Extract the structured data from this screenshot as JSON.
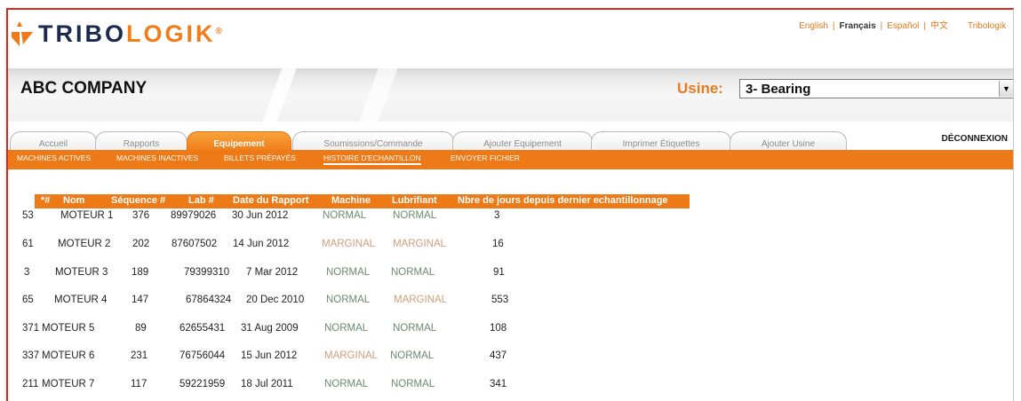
{
  "header": {
    "brand": {
      "part1": "TRIBO",
      "part2": "LOGIK",
      "mark": "®"
    },
    "languages": [
      "English",
      "Français",
      "Español",
      "中文"
    ],
    "active_language": "Français",
    "brand_link": "Tribologik"
  },
  "company": "ABC COMPANY",
  "usine": {
    "label": "Usine:",
    "selected": "3- Bearing"
  },
  "tabs": [
    {
      "label": "Accueil"
    },
    {
      "label": "Rapports"
    },
    {
      "label": "Equipement"
    },
    {
      "label": "Soumissions/Commande"
    },
    {
      "label": "Ajouter Equipement"
    },
    {
      "label": "Imprimer Étiquettes"
    },
    {
      "label": "Ajouter Usine"
    }
  ],
  "active_tab": "Equipement",
  "logout": "DÉCONNEXION",
  "subnav": [
    {
      "label": "MACHINES ACTIVES"
    },
    {
      "label": "MACHINES INACTIVES"
    },
    {
      "label": "BILLETS PRÉPAYÉS"
    },
    {
      "label": "HISTOIRE D'ECHANTILLON"
    },
    {
      "label": "ENVOYER FICHIER"
    }
  ],
  "active_subnav": "HISTOIRE D'ECHANTILLON",
  "table": {
    "headers": [
      "*#",
      "Nom",
      "Séquence #",
      "Lab #",
      "Date du Rapport",
      "Machine",
      "Lubrifiant",
      "Nbre de jours depuis dernier echantillonnage"
    ],
    "rows": [
      {
        "num": "53",
        "nom": "MOTEUR 1",
        "seq": "376",
        "lab": "89979026",
        "date": "30 Jun 2012",
        "machine": "NORMAL",
        "lub": "NORMAL",
        "days": "3"
      },
      {
        "num": "61",
        "nom": "MOTEUR 2",
        "seq": "202",
        "lab": "87607502",
        "date": "14 Jun 2012",
        "machine": "MARGINAL",
        "lub": "MARGINAL",
        "days": "16"
      },
      {
        "num": "3",
        "nom": "MOTEUR 3",
        "seq": "189",
        "lab": "79399310",
        "date": "7 Mar 2012",
        "machine": "NORMAL",
        "lub": "NORMAL",
        "days": "91"
      },
      {
        "num": "65",
        "nom": "MOTEUR 4",
        "seq": "147",
        "lab": "67864324",
        "date": "20 Dec 2010",
        "machine": "NORMAL",
        "lub": "MARGINAL",
        "days": "553"
      },
      {
        "num": "371",
        "nom": "MOTEUR 5",
        "seq": "89",
        "lab": "62655431",
        "date": "31 Aug 2009",
        "machine": "NORMAL",
        "lub": "NORMAL",
        "days": "108"
      },
      {
        "num": "337",
        "nom": "MOTEUR 6",
        "seq": "231",
        "lab": "76756044",
        "date": "15 Jun 2012",
        "machine": "MARGINAL",
        "lub": "NORMAL",
        "days": "437"
      },
      {
        "num": "211",
        "nom": "MOTEUR 7",
        "seq": "117",
        "lab": "59221959",
        "date": "18 Jul 2011",
        "machine": "NORMAL",
        "lub": "NORMAL",
        "days": "341"
      }
    ]
  },
  "colors": {
    "accent": "#ee7a17",
    "brand_navy": "#1a2a4c",
    "status_normal": "#6d8a70",
    "status_marginal": "#cf9f7a",
    "frame_border": "#d9281e"
  },
  "icons": {
    "logo": "tribologik-flame-logo",
    "select_arrow": "chevron-down-icon"
  }
}
